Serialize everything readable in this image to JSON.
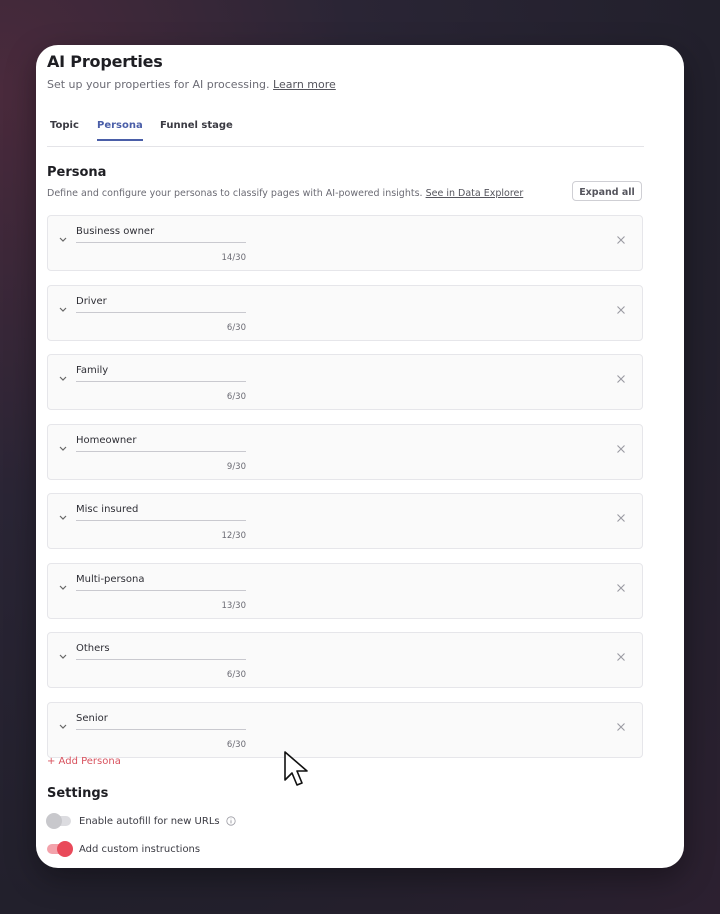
{
  "header": {
    "title": "AI Properties",
    "subtitle": "Set up your properties for AI processing.",
    "learn_more": "Learn more"
  },
  "tabs": [
    {
      "label": "Topic",
      "active": false
    },
    {
      "label": "Persona",
      "active": true
    },
    {
      "label": "Funnel stage",
      "active": false
    }
  ],
  "section": {
    "title": "Persona",
    "description": "Define and configure your personas to classify pages with AI-powered insights.",
    "link": "See in Data Explorer",
    "expand_all": "Expand all"
  },
  "personas": [
    {
      "name": "Business owner",
      "count": "14/30"
    },
    {
      "name": "Driver",
      "count": "6/30"
    },
    {
      "name": "Family",
      "count": "6/30"
    },
    {
      "name": "Homeowner",
      "count": "9/30"
    },
    {
      "name": "Misc insured",
      "count": "12/30"
    },
    {
      "name": "Multi-persona",
      "count": "13/30"
    },
    {
      "name": "Others",
      "count": "6/30"
    },
    {
      "name": "Senior",
      "count": "6/30"
    }
  ],
  "add_persona": "+ Add Persona",
  "settings": {
    "title": "Settings",
    "autofill": {
      "label": "Enable autofill for new URLs",
      "enabled": false
    },
    "custom_instructions": {
      "label": "Add custom instructions",
      "enabled": true
    }
  },
  "colors": {
    "accent": "#4a5ea8",
    "danger": "#d8515d",
    "toggle_on": "#e94a5a"
  }
}
